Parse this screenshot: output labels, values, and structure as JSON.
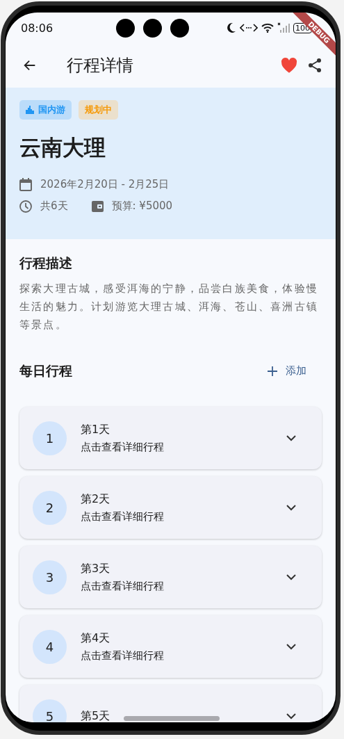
{
  "status_bar": {
    "time": "08:06",
    "battery": "100"
  },
  "debug_banner": "DEBUG",
  "app_bar": {
    "title": "行程详情",
    "favorite": true
  },
  "trip": {
    "tags": [
      {
        "label": "国内游",
        "kind": "category"
      },
      {
        "label": "规划中",
        "kind": "status"
      }
    ],
    "title": "云南大理",
    "dates": "2026年2月20日 - 2月25日",
    "duration": "共6天",
    "budget": "预算: ¥5000"
  },
  "description": {
    "heading": "行程描述",
    "text": "探索大理古城，感受洱海的宁静，品尝白族美食，体验慢生活的魅力。计划游览大理古城、洱海、苍山、喜洲古镇等景点。"
  },
  "daily": {
    "heading": "每日行程",
    "add_label": "添加",
    "days": [
      {
        "number": "1",
        "title": "第1天",
        "subtitle": "点击查看详细行程",
        "expanded": false
      },
      {
        "number": "2",
        "title": "第2天",
        "subtitle": "点击查看详细行程",
        "expanded": false
      },
      {
        "number": "3",
        "title": "第3天",
        "subtitle": "点击查看详细行程",
        "expanded": false
      },
      {
        "number": "4",
        "title": "第4天",
        "subtitle": "点击查看详细行程",
        "expanded": false
      },
      {
        "number": "5",
        "title": "第5天",
        "expanded": false
      }
    ]
  }
}
